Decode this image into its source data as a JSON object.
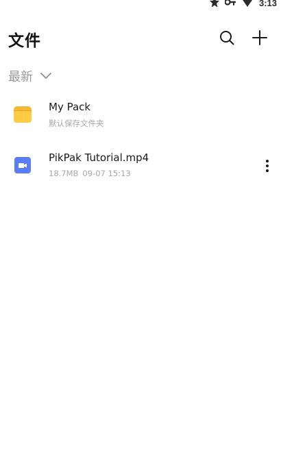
{
  "status_bar": {
    "time": "3:13",
    "icons": [
      "star-icon",
      "key-icon",
      "wifi-icon"
    ]
  },
  "app_bar": {
    "title": "文件",
    "search_icon": "search-icon",
    "add_icon": "plus-icon"
  },
  "sort": {
    "label": "最新",
    "icon": "chevron-down-icon"
  },
  "files": [
    {
      "name": "My Pack",
      "subtitle": "默认保存文件夹",
      "icon": "folder-icon",
      "icon_color": "#F7B731"
    },
    {
      "name": "PikPak Tutorial.mp4",
      "size": "18.7MB",
      "date": "09-07 15:13",
      "icon": "video-file-icon",
      "icon_color": "#5B7CF7",
      "more_icon": "more-vertical-icon"
    }
  ],
  "colors": {
    "background": "#FFFFFF",
    "title": "#111111",
    "secondary_text": "#A8A8A8",
    "sort_text": "#9A9A9A"
  }
}
